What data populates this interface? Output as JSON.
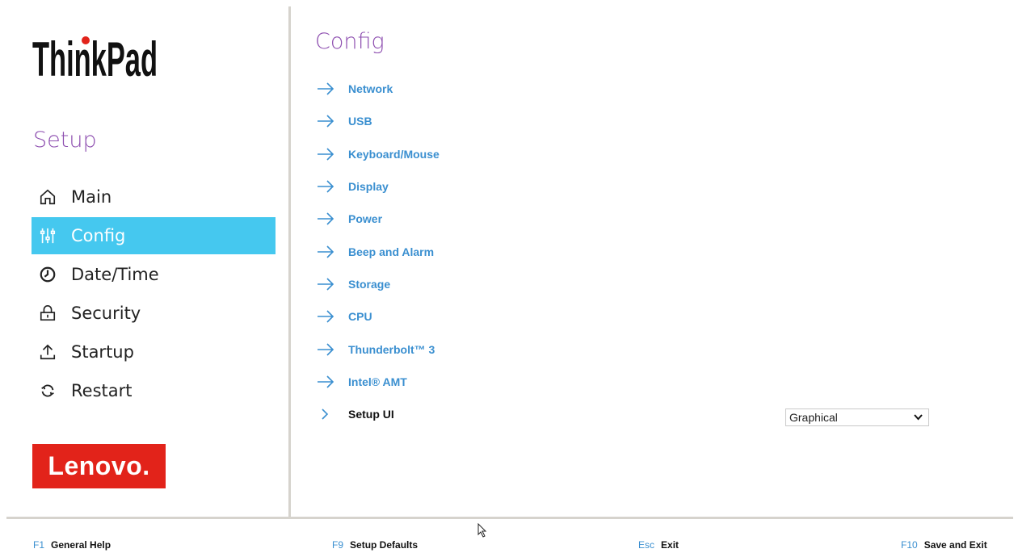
{
  "brand": {
    "thinkpad": "ThinkPad",
    "lenovo": "Lenovo."
  },
  "sidebar": {
    "heading": "Setup",
    "items": [
      {
        "label": "Main",
        "icon": "home-icon",
        "active": false
      },
      {
        "label": "Config",
        "icon": "sliders-icon",
        "active": true
      },
      {
        "label": "Date/Time",
        "icon": "clock-icon",
        "active": false
      },
      {
        "label": "Security",
        "icon": "lock-icon",
        "active": false
      },
      {
        "label": "Startup",
        "icon": "upload-icon",
        "active": false
      },
      {
        "label": "Restart",
        "icon": "refresh-icon",
        "active": false
      }
    ]
  },
  "main": {
    "title": "Config",
    "submenus": [
      "Network",
      "USB",
      "Keyboard/Mouse",
      "Display",
      "Power",
      "Beep and Alarm",
      "Storage",
      "CPU",
      "Thunderbolt™ 3",
      "Intel® AMT"
    ],
    "setting": {
      "label": "Setup UI",
      "value": "Graphical"
    }
  },
  "footer": {
    "help": {
      "key": "F1",
      "label": "General Help"
    },
    "defaults": {
      "key": "F9",
      "label": "Setup Defaults"
    },
    "exit": {
      "key": "Esc",
      "label": "Exit"
    },
    "save": {
      "key": "F10",
      "label": "Save and Exit"
    }
  },
  "colors": {
    "accent": "#45c8ef",
    "heading": "#8e4fb0",
    "link": "#3a8fd0",
    "lenovo_red": "#e2231a"
  }
}
